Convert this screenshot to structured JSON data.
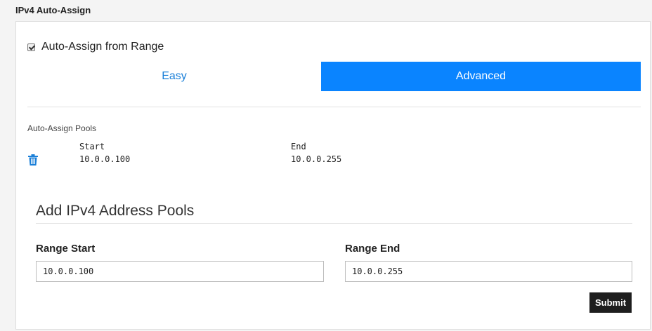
{
  "section": {
    "title": "IPv4 Auto-Assign"
  },
  "auto_assign": {
    "label": "Auto-Assign from Range",
    "checked": true
  },
  "mode_tabs": [
    {
      "label": "Easy",
      "active": false
    },
    {
      "label": "Advanced",
      "active": true
    }
  ],
  "pools": {
    "label": "Auto-Assign Pools",
    "start_header": "Start",
    "end_header": "End",
    "rows": [
      {
        "start": "10.0.0.100",
        "end": "10.0.0.255"
      }
    ]
  },
  "add_form": {
    "title": "Add IPv4 Address Pools",
    "range_start_label": "Range Start",
    "range_start_value": "10.0.0.100",
    "range_end_label": "Range End",
    "range_end_value": "10.0.0.255",
    "submit_label": "Submit"
  },
  "colors": {
    "accent": "#0a84ff",
    "tab_text": "#1a7fd8",
    "submit_bg": "#1e1e1e"
  },
  "icons": {
    "delete": "trash-icon"
  }
}
